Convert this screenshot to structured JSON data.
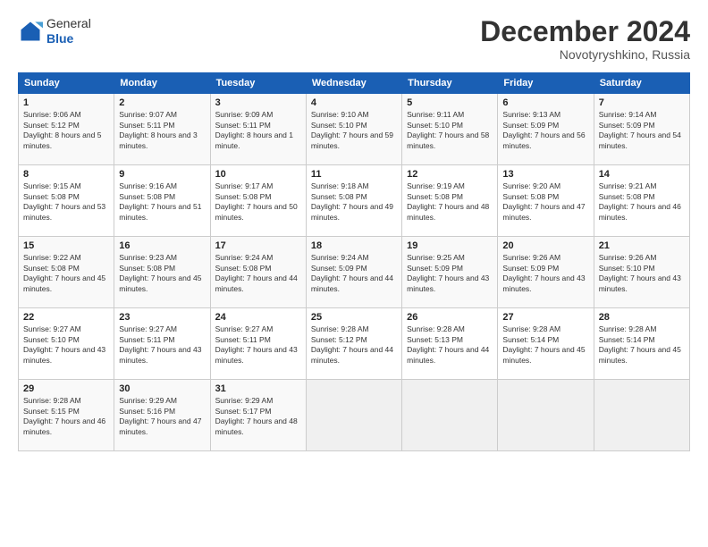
{
  "header": {
    "logo": {
      "line1": "General",
      "line2": "Blue"
    },
    "title": "December 2024",
    "location": "Novotyryshkino, Russia"
  },
  "weekdays": [
    "Sunday",
    "Monday",
    "Tuesday",
    "Wednesday",
    "Thursday",
    "Friday",
    "Saturday"
  ],
  "weeks": [
    [
      {
        "day": "1",
        "sunrise": "9:06 AM",
        "sunset": "5:12 PM",
        "daylight": "8 hours and 5 minutes."
      },
      {
        "day": "2",
        "sunrise": "9:07 AM",
        "sunset": "5:11 PM",
        "daylight": "8 hours and 3 minutes."
      },
      {
        "day": "3",
        "sunrise": "9:09 AM",
        "sunset": "5:11 PM",
        "daylight": "8 hours and 1 minute."
      },
      {
        "day": "4",
        "sunrise": "9:10 AM",
        "sunset": "5:10 PM",
        "daylight": "7 hours and 59 minutes."
      },
      {
        "day": "5",
        "sunrise": "9:11 AM",
        "sunset": "5:10 PM",
        "daylight": "7 hours and 58 minutes."
      },
      {
        "day": "6",
        "sunrise": "9:13 AM",
        "sunset": "5:09 PM",
        "daylight": "7 hours and 56 minutes."
      },
      {
        "day": "7",
        "sunrise": "9:14 AM",
        "sunset": "5:09 PM",
        "daylight": "7 hours and 54 minutes."
      }
    ],
    [
      {
        "day": "8",
        "sunrise": "9:15 AM",
        "sunset": "5:08 PM",
        "daylight": "7 hours and 53 minutes."
      },
      {
        "day": "9",
        "sunrise": "9:16 AM",
        "sunset": "5:08 PM",
        "daylight": "7 hours and 51 minutes."
      },
      {
        "day": "10",
        "sunrise": "9:17 AM",
        "sunset": "5:08 PM",
        "daylight": "7 hours and 50 minutes."
      },
      {
        "day": "11",
        "sunrise": "9:18 AM",
        "sunset": "5:08 PM",
        "daylight": "7 hours and 49 minutes."
      },
      {
        "day": "12",
        "sunrise": "9:19 AM",
        "sunset": "5:08 PM",
        "daylight": "7 hours and 48 minutes."
      },
      {
        "day": "13",
        "sunrise": "9:20 AM",
        "sunset": "5:08 PM",
        "daylight": "7 hours and 47 minutes."
      },
      {
        "day": "14",
        "sunrise": "9:21 AM",
        "sunset": "5:08 PM",
        "daylight": "7 hours and 46 minutes."
      }
    ],
    [
      {
        "day": "15",
        "sunrise": "9:22 AM",
        "sunset": "5:08 PM",
        "daylight": "7 hours and 45 minutes."
      },
      {
        "day": "16",
        "sunrise": "9:23 AM",
        "sunset": "5:08 PM",
        "daylight": "7 hours and 45 minutes."
      },
      {
        "day": "17",
        "sunrise": "9:24 AM",
        "sunset": "5:08 PM",
        "daylight": "7 hours and 44 minutes."
      },
      {
        "day": "18",
        "sunrise": "9:24 AM",
        "sunset": "5:09 PM",
        "daylight": "7 hours and 44 minutes."
      },
      {
        "day": "19",
        "sunrise": "9:25 AM",
        "sunset": "5:09 PM",
        "daylight": "7 hours and 43 minutes."
      },
      {
        "day": "20",
        "sunrise": "9:26 AM",
        "sunset": "5:09 PM",
        "daylight": "7 hours and 43 minutes."
      },
      {
        "day": "21",
        "sunrise": "9:26 AM",
        "sunset": "5:10 PM",
        "daylight": "7 hours and 43 minutes."
      }
    ],
    [
      {
        "day": "22",
        "sunrise": "9:27 AM",
        "sunset": "5:10 PM",
        "daylight": "7 hours and 43 minutes."
      },
      {
        "day": "23",
        "sunrise": "9:27 AM",
        "sunset": "5:11 PM",
        "daylight": "7 hours and 43 minutes."
      },
      {
        "day": "24",
        "sunrise": "9:27 AM",
        "sunset": "5:11 PM",
        "daylight": "7 hours and 43 minutes."
      },
      {
        "day": "25",
        "sunrise": "9:28 AM",
        "sunset": "5:12 PM",
        "daylight": "7 hours and 44 minutes."
      },
      {
        "day": "26",
        "sunrise": "9:28 AM",
        "sunset": "5:13 PM",
        "daylight": "7 hours and 44 minutes."
      },
      {
        "day": "27",
        "sunrise": "9:28 AM",
        "sunset": "5:14 PM",
        "daylight": "7 hours and 45 minutes."
      },
      {
        "day": "28",
        "sunrise": "9:28 AM",
        "sunset": "5:14 PM",
        "daylight": "7 hours and 45 minutes."
      }
    ],
    [
      {
        "day": "29",
        "sunrise": "9:28 AM",
        "sunset": "5:15 PM",
        "daylight": "7 hours and 46 minutes."
      },
      {
        "day": "30",
        "sunrise": "9:29 AM",
        "sunset": "5:16 PM",
        "daylight": "7 hours and 47 minutes."
      },
      {
        "day": "31",
        "sunrise": "9:29 AM",
        "sunset": "5:17 PM",
        "daylight": "7 hours and 48 minutes."
      },
      null,
      null,
      null,
      null
    ]
  ]
}
